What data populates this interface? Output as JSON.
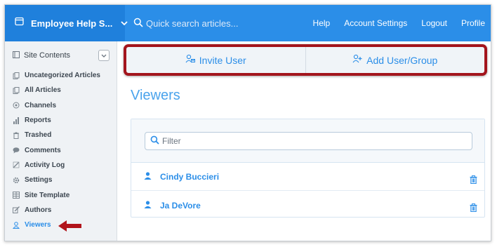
{
  "header": {
    "site_name": "Employee Help S...",
    "search_placeholder": "Quick search articles...",
    "nav": [
      "Help",
      "Account Settings",
      "Logout",
      "Profile"
    ]
  },
  "sidebar": {
    "heading": "Site Contents",
    "items": [
      {
        "label": "Uncategorized Articles",
        "icon": "articles-icon"
      },
      {
        "label": "All Articles",
        "icon": "articles-icon"
      },
      {
        "label": "Channels",
        "icon": "channels-icon"
      },
      {
        "label": "Reports",
        "icon": "reports-icon"
      },
      {
        "label": "Trashed",
        "icon": "trash-icon"
      },
      {
        "label": "Comments",
        "icon": "comments-icon"
      },
      {
        "label": "Activity Log",
        "icon": "activity-icon"
      },
      {
        "label": "Settings",
        "icon": "settings-icon"
      },
      {
        "label": "Site Template",
        "icon": "template-icon"
      },
      {
        "label": "Authors",
        "icon": "authors-icon"
      },
      {
        "label": "Viewers",
        "icon": "viewers-icon",
        "active": true
      }
    ]
  },
  "actions": {
    "invite": "Invite User",
    "add": "Add User/Group"
  },
  "main": {
    "title": "Viewers",
    "filter_placeholder": "Filter",
    "users": [
      "Cindy Buccieri",
      "Ja DeVore"
    ]
  },
  "colors": {
    "accent": "#2b8ee8",
    "highlight": "#a3151d"
  }
}
